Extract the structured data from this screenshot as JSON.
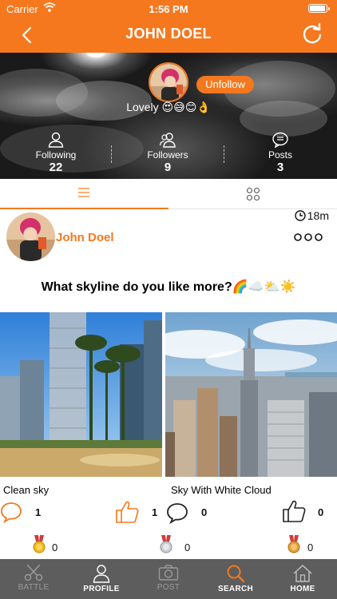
{
  "status_bar": {
    "carrier": "Carrier",
    "time": "1:56 PM"
  },
  "nav": {
    "title": "JOHN DOEL"
  },
  "profile": {
    "bio": "Lovely 😍😅😊👌",
    "unfollow_label": "Unfollow",
    "stats": [
      {
        "label": "Following",
        "value": "22",
        "icon": "person-icon"
      },
      {
        "label": "Followers",
        "value": "9",
        "icon": "people-icon"
      },
      {
        "label": "Posts",
        "value": "3",
        "icon": "chat-bubble-icon"
      }
    ]
  },
  "tabs": [
    {
      "icon": "list-view-icon",
      "active": true
    },
    {
      "icon": "grid-view-icon",
      "active": false
    }
  ],
  "post": {
    "author": "John Doel",
    "time": "18m",
    "question": "What skyline do you like more?🌈☁️⛅☀️",
    "options": [
      {
        "caption": "Clean sky",
        "comments": "1",
        "likes": "1",
        "medals": "0",
        "medal": "gold-medal-icon"
      },
      {
        "caption": "Sky With White Cloud",
        "comments": "0",
        "likes": "0",
        "medals_silver": "0",
        "medals_gold": "0"
      }
    ]
  },
  "tabbar": [
    {
      "label": "BATTLE",
      "icon": "scissors-icon",
      "active": false
    },
    {
      "label": "PROFILE",
      "icon": "person-icon",
      "active": true
    },
    {
      "label": "POST",
      "icon": "camera-icon",
      "active": false
    },
    {
      "label": "SEARCH",
      "icon": "search-icon",
      "active": true,
      "accent": true
    },
    {
      "label": "HOME",
      "icon": "home-icon",
      "active": true
    }
  ],
  "colors": {
    "accent": "#f5781e",
    "tabbar": "#5d5d5d",
    "inactive_tab": "#9a9a9a"
  }
}
